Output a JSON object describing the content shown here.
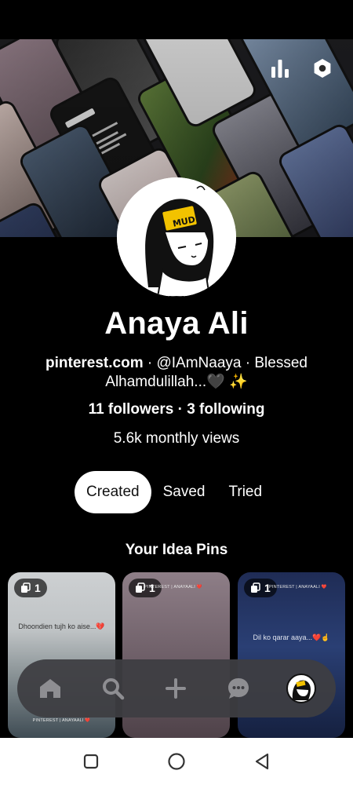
{
  "cover": {
    "analytics_icon": "bar-chart-icon",
    "settings_icon": "hexagon-gear-icon"
  },
  "profile": {
    "name": "Anaya Ali",
    "website": "pinterest.com",
    "bio_rest": " · @IAmNaaya · Blessed Alhamdulillah...🖤 ✨",
    "stats": "11 followers · 3 following",
    "monthly_views": "5.6k monthly views",
    "avatar_badge_text": "MUD"
  },
  "tabs": [
    {
      "label": "Created",
      "active": true
    },
    {
      "label": "Saved",
      "active": false
    },
    {
      "label": "Tried",
      "active": false
    }
  ],
  "section": {
    "title": "Your Idea Pins"
  },
  "pins": [
    {
      "badge_count": "1",
      "overlay_text": "Dhoondien tujh ko aise...💔",
      "caption": "PINTEREST | ANAYAALI ❤️"
    },
    {
      "badge_count": "1",
      "overlay_text": "",
      "caption": "PINTEREST | ANAYAALI ❤️"
    },
    {
      "badge_count": "1",
      "overlay_text": "Dil ko qarar aaya...❤️☝",
      "caption": "PINTEREST | ANAYAALI ❤️"
    }
  ],
  "navbar": {
    "items": [
      "home-icon",
      "search-icon",
      "plus-icon",
      "chat-icon",
      "profile-avatar"
    ],
    "active": "home-icon"
  },
  "system_nav": [
    "recents-square-icon",
    "home-circle-icon",
    "back-triangle-icon"
  ]
}
